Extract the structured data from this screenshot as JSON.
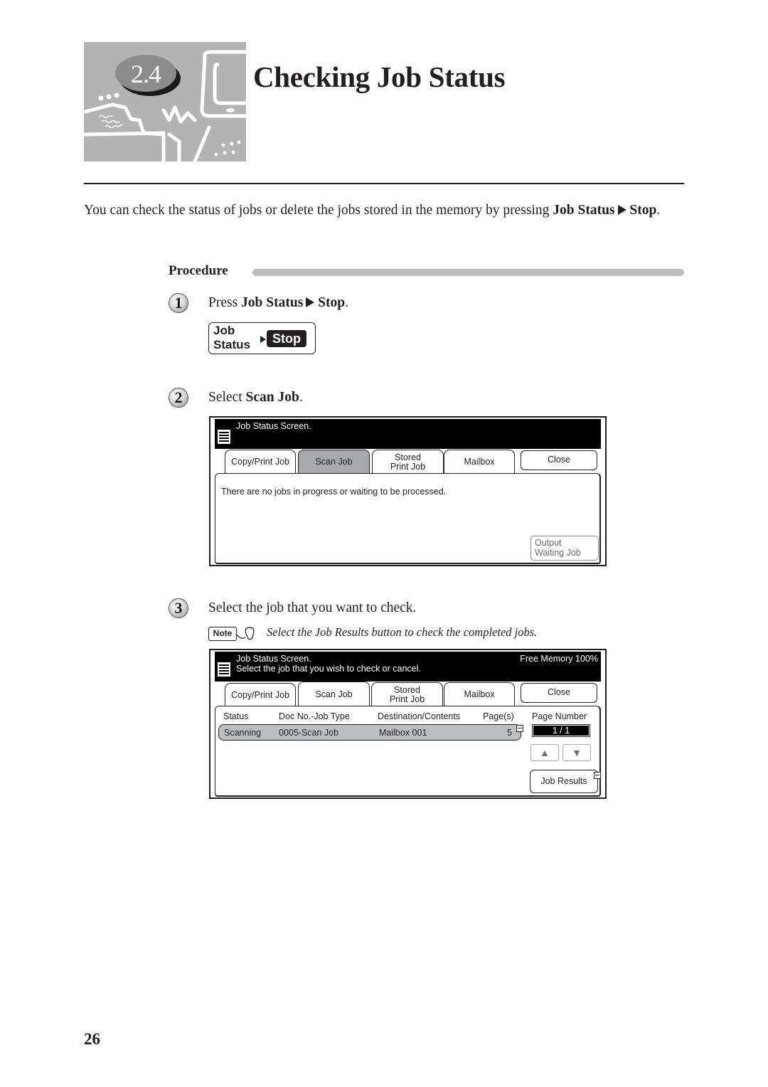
{
  "header": {
    "section_number": "2.4",
    "title": "Checking Job Status"
  },
  "intro": {
    "text_before": "You can check the status of jobs or delete the jobs stored in the memory by pressing ",
    "key1": "Job Status",
    "key2": "Stop",
    "text_after": "."
  },
  "procedure": {
    "label": "Procedure",
    "steps": [
      {
        "number": "1",
        "text_before": "Press ",
        "bold1": "Job Status",
        "bold2": "Stop",
        "text_after": "."
      },
      {
        "number": "2",
        "text_before": "Select ",
        "bold": "Scan Job",
        "text_after": "."
      },
      {
        "number": "3",
        "text": "Select the job that you want to check."
      }
    ]
  },
  "key_graphic": {
    "line1": "Job",
    "line2": "Status",
    "stop": "Stop"
  },
  "screen1": {
    "message": "Job Status Screen.",
    "tabs": [
      {
        "label": "Copy/Print Job"
      },
      {
        "label": "Scan Job"
      },
      {
        "label_line1": "Stored",
        "label_line2": "Print Job"
      },
      {
        "label": "Mailbox"
      }
    ],
    "close_label": "Close",
    "content_message": "There are no jobs in progress or waiting to be processed.",
    "output_waiting": {
      "line1": "Output",
      "line2": "Waiting Job"
    }
  },
  "note": {
    "badge": "Note",
    "text": "Select the Job Results button to check the completed jobs."
  },
  "screen2": {
    "message_line1": "Job Status Screen.",
    "message_line2": "Select the job that you wish to check or cancel.",
    "free_memory": "Free Memory  100%",
    "tabs": [
      {
        "label": "Copy/Print Job"
      },
      {
        "label": "Scan Job"
      },
      {
        "label_line1": "Stored",
        "label_line2": "Print Job"
      },
      {
        "label": "Mailbox"
      }
    ],
    "close_label": "Close",
    "columns": [
      "Status",
      "Doc No.-Job Type",
      "Destination/Contents",
      "Page(s)"
    ],
    "page_number_label": "Page Number",
    "page_number_value": "1 /  1",
    "rows": [
      {
        "status": "Scanning",
        "doc": "0005-Scan Job",
        "destination": "Mailbox 001",
        "pages": "5"
      }
    ],
    "up_label": "▲",
    "down_label": "▼",
    "job_results_label": "Job Results"
  },
  "footer": {
    "page_number": "26"
  }
}
